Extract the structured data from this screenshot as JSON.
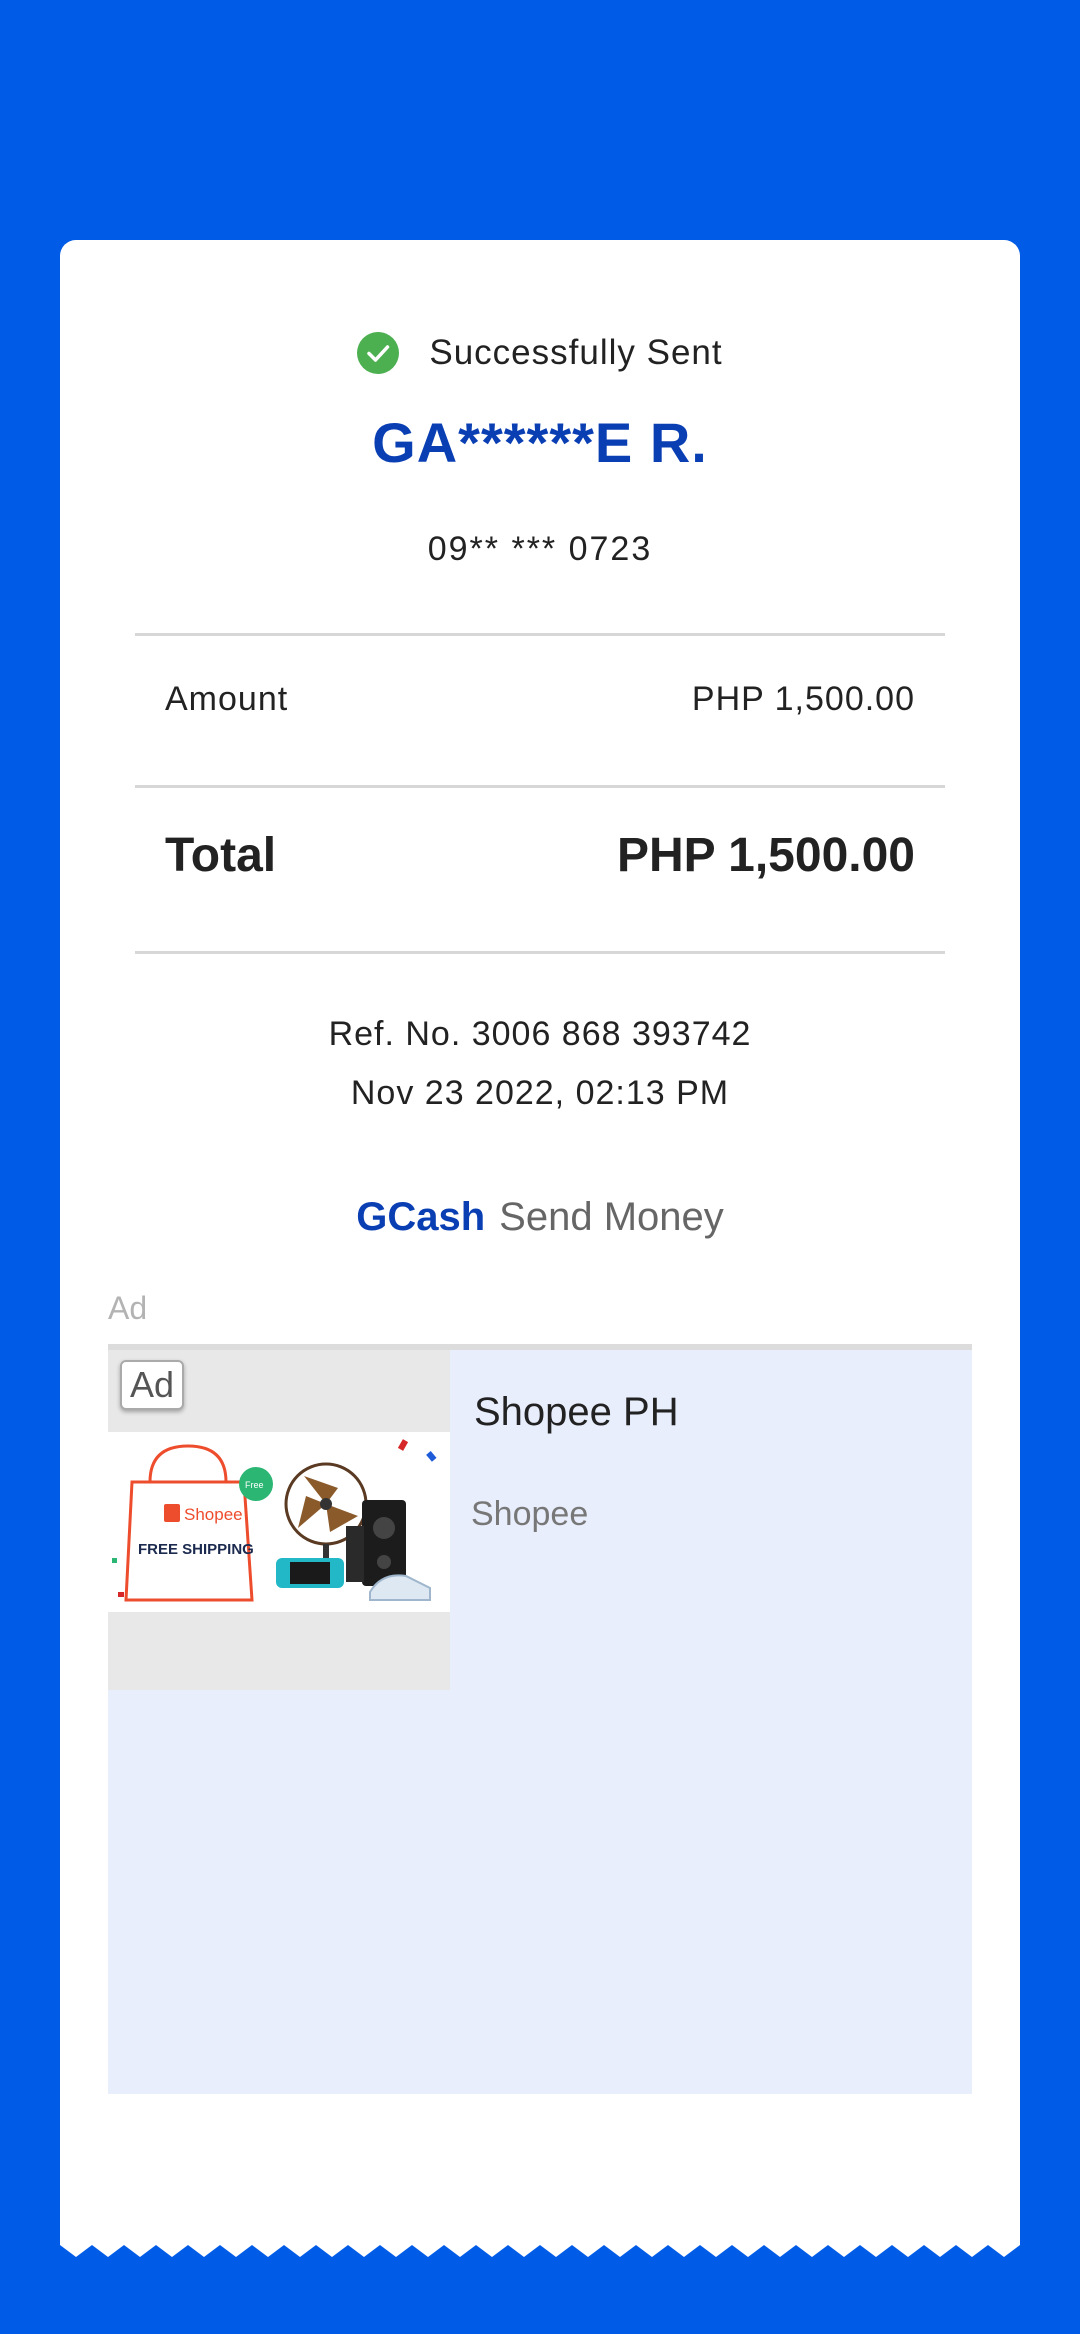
{
  "status": {
    "text": "Successfully Sent",
    "icon": "check-circle-icon",
    "color": "#4caf50"
  },
  "recipient": {
    "name": "GA******E R.",
    "phone": "09** *** 0723"
  },
  "amount": {
    "label": "Amount",
    "value": "PHP 1,500.00"
  },
  "total": {
    "label": "Total",
    "value": "PHP 1,500.00"
  },
  "reference": {
    "ref_line": "Ref. No. 3006 868 393742",
    "date_line": "Nov 23 2022, 02:13 PM"
  },
  "brand": {
    "logo_text": "GCash",
    "service": "Send Money"
  },
  "ad": {
    "caption": "Ad",
    "badge": "Ad",
    "title": "Shopee PH",
    "advertiser": "Shopee",
    "image_brand": "Shopee",
    "image_tagline": "FREE SHIPPING",
    "image_truck_label": "Free"
  },
  "colors": {
    "background": "#005ce6",
    "brand_blue": "#0a3fb4",
    "ad_background": "#e8eefc",
    "shopee_orange": "#ee4d2d"
  }
}
